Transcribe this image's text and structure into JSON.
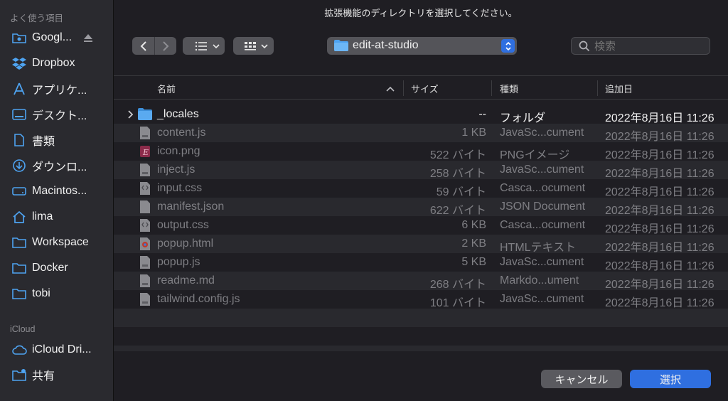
{
  "dialog_title": "拡張機能のディレクトリを選択してください。",
  "sidebar": {
    "favorites_title": "よく使う項目",
    "favorites": [
      {
        "label": "Googl...",
        "icon": "cloud-drive-icon",
        "eject": true
      },
      {
        "label": "Dropbox",
        "icon": "dropbox-icon"
      },
      {
        "label": "アプリケ...",
        "icon": "applications-icon"
      },
      {
        "label": "デスクト...",
        "icon": "desktop-icon"
      },
      {
        "label": "書類",
        "icon": "document-icon"
      },
      {
        "label": "ダウンロ...",
        "icon": "download-icon"
      },
      {
        "label": "Macintos...",
        "icon": "hard-drive-icon"
      },
      {
        "label": "lima",
        "icon": "home-icon"
      },
      {
        "label": "Workspace",
        "icon": "folder-icon"
      },
      {
        "label": "Docker",
        "icon": "folder-icon"
      },
      {
        "label": "tobi",
        "icon": "folder-icon"
      }
    ],
    "icloud_title": "iCloud",
    "icloud": [
      {
        "label": "iCloud Dri...",
        "icon": "icloud-icon"
      },
      {
        "label": "共有",
        "icon": "shared-folder-icon"
      }
    ]
  },
  "toolbar": {
    "current_folder": "edit-at-studio",
    "search_placeholder": "検索"
  },
  "columns": {
    "name": "名前",
    "size": "サイズ",
    "kind": "種類",
    "date": "追加日"
  },
  "files": [
    {
      "name": "_locales",
      "size": "--",
      "kind": "フォルダ",
      "date": "2022年8月16日 11:26",
      "type": "folder",
      "active": true
    },
    {
      "name": "content.js",
      "size": "1 KB",
      "kind": "JavaSc...cument",
      "date": "2022年8月16日 11:26",
      "type": "js"
    },
    {
      "name": "icon.png",
      "size": "522 バイト",
      "kind": "PNGイメージ",
      "date": "2022年8月16日 11:26",
      "type": "png"
    },
    {
      "name": "inject.js",
      "size": "258 バイト",
      "kind": "JavaSc...cument",
      "date": "2022年8月16日 11:26",
      "type": "js"
    },
    {
      "name": "input.css",
      "size": "59 バイト",
      "kind": "Casca...ocument",
      "date": "2022年8月16日 11:26",
      "type": "css"
    },
    {
      "name": "manifest.json",
      "size": "622 バイト",
      "kind": "JSON Document",
      "date": "2022年8月16日 11:26",
      "type": "json"
    },
    {
      "name": "output.css",
      "size": "6 KB",
      "kind": "Casca...ocument",
      "date": "2022年8月16日 11:26",
      "type": "css"
    },
    {
      "name": "popup.html",
      "size": "2 KB",
      "kind": "HTMLテキスト",
      "date": "2022年8月16日 11:26",
      "type": "html"
    },
    {
      "name": "popup.js",
      "size": "5 KB",
      "kind": "JavaSc...cument",
      "date": "2022年8月16日 11:26",
      "type": "js"
    },
    {
      "name": "readme.md",
      "size": "268 バイト",
      "kind": "Markdo...ument",
      "date": "2022年8月16日 11:26",
      "type": "md"
    },
    {
      "name": "tailwind.config.js",
      "size": "101 バイト",
      "kind": "JavaSc...cument",
      "date": "2022年8月16日 11:26",
      "type": "js"
    }
  ],
  "buttons": {
    "cancel": "キャンセル",
    "select": "選択"
  },
  "colors": {
    "accent": "#2f6fe0",
    "folder_blue": "#4ea3f1",
    "primary_button": "#2f6fe0"
  }
}
